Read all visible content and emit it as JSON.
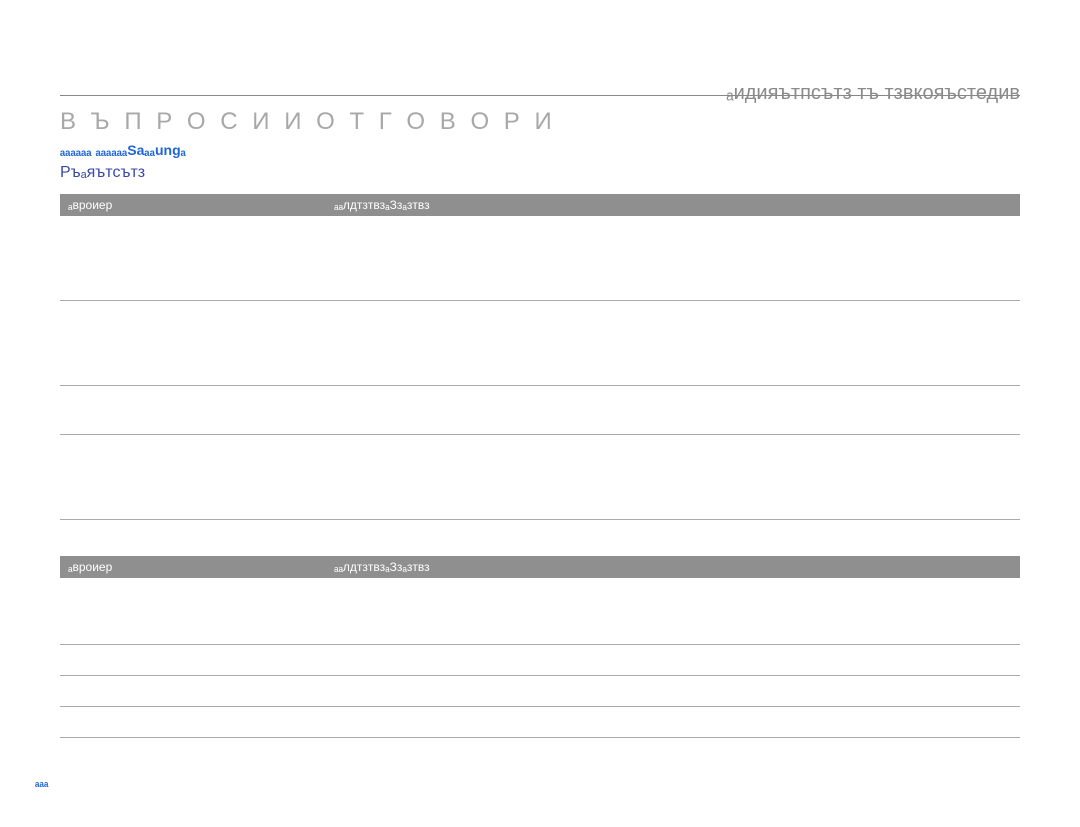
{
  "header_right": "ₐидияътпсътз тъ тзвкояъстедив",
  "heading": "В Ъ П Р О С И   И   О Т Г О В О Р И",
  "subheading_link": "ₐₐₐₐₐₐ ₐₐₐₐₐₐSaₐₐungₐ",
  "section_title": "Ръₐяътсътз",
  "table1": {
    "th1": "ₐвроиер",
    "th2": "ₐₐлдтзтвзₐЗзₐзтвз",
    "rows": [
      {
        "c1": "",
        "c2_lines": [
          "",
          "",
          "",
          ""
        ]
      },
      {
        "c1": "",
        "c2_lines": [
          "",
          "",
          "",
          ""
        ]
      },
      {
        "c1": "",
        "c2_lines": [
          "",
          ""
        ]
      },
      {
        "c1": "",
        "c2_lines": [
          "",
          "",
          "",
          ""
        ]
      }
    ]
  },
  "table2": {
    "th1": "ₐвроиер",
    "th2": "ₐₐлдтзтвзₐЗзₐзтвз",
    "rows": [
      {
        "c1": "",
        "c2_lines": [
          "",
          "",
          ""
        ]
      },
      {
        "c1": "",
        "c2_lines": [
          ""
        ]
      },
      {
        "c1": "",
        "c2_lines": [
          ""
        ]
      },
      {
        "c1": "",
        "c2_lines": [
          ""
        ]
      }
    ]
  },
  "page_number": "ₐₐₐ"
}
